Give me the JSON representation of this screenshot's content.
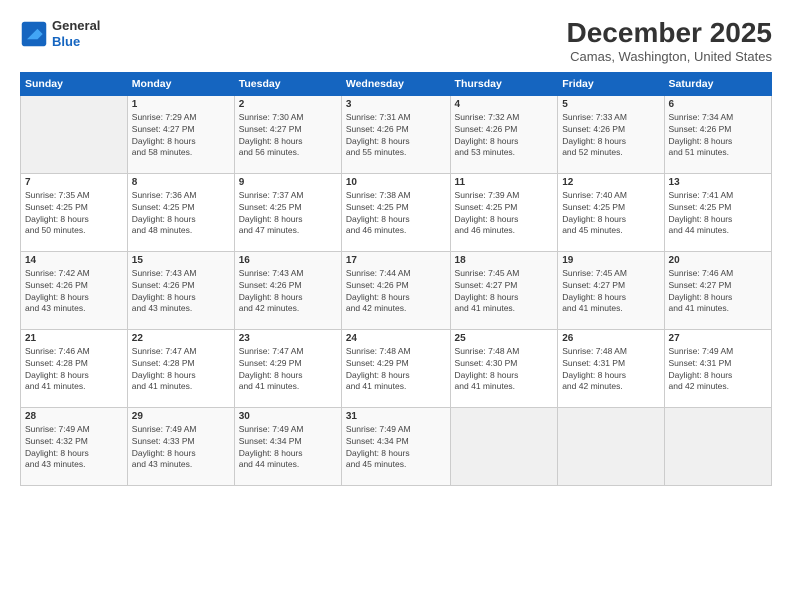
{
  "logo": {
    "line1": "General",
    "line2": "Blue"
  },
  "title": "December 2025",
  "location": "Camas, Washington, United States",
  "days_of_week": [
    "Sunday",
    "Monday",
    "Tuesday",
    "Wednesday",
    "Thursday",
    "Friday",
    "Saturday"
  ],
  "weeks": [
    [
      {
        "day": "",
        "info": ""
      },
      {
        "day": "1",
        "info": "Sunrise: 7:29 AM\nSunset: 4:27 PM\nDaylight: 8 hours\nand 58 minutes."
      },
      {
        "day": "2",
        "info": "Sunrise: 7:30 AM\nSunset: 4:27 PM\nDaylight: 8 hours\nand 56 minutes."
      },
      {
        "day": "3",
        "info": "Sunrise: 7:31 AM\nSunset: 4:26 PM\nDaylight: 8 hours\nand 55 minutes."
      },
      {
        "day": "4",
        "info": "Sunrise: 7:32 AM\nSunset: 4:26 PM\nDaylight: 8 hours\nand 53 minutes."
      },
      {
        "day": "5",
        "info": "Sunrise: 7:33 AM\nSunset: 4:26 PM\nDaylight: 8 hours\nand 52 minutes."
      },
      {
        "day": "6",
        "info": "Sunrise: 7:34 AM\nSunset: 4:26 PM\nDaylight: 8 hours\nand 51 minutes."
      }
    ],
    [
      {
        "day": "7",
        "info": "Sunrise: 7:35 AM\nSunset: 4:25 PM\nDaylight: 8 hours\nand 50 minutes."
      },
      {
        "day": "8",
        "info": "Sunrise: 7:36 AM\nSunset: 4:25 PM\nDaylight: 8 hours\nand 48 minutes."
      },
      {
        "day": "9",
        "info": "Sunrise: 7:37 AM\nSunset: 4:25 PM\nDaylight: 8 hours\nand 47 minutes."
      },
      {
        "day": "10",
        "info": "Sunrise: 7:38 AM\nSunset: 4:25 PM\nDaylight: 8 hours\nand 46 minutes."
      },
      {
        "day": "11",
        "info": "Sunrise: 7:39 AM\nSunset: 4:25 PM\nDaylight: 8 hours\nand 46 minutes."
      },
      {
        "day": "12",
        "info": "Sunrise: 7:40 AM\nSunset: 4:25 PM\nDaylight: 8 hours\nand 45 minutes."
      },
      {
        "day": "13",
        "info": "Sunrise: 7:41 AM\nSunset: 4:25 PM\nDaylight: 8 hours\nand 44 minutes."
      }
    ],
    [
      {
        "day": "14",
        "info": "Sunrise: 7:42 AM\nSunset: 4:26 PM\nDaylight: 8 hours\nand 43 minutes."
      },
      {
        "day": "15",
        "info": "Sunrise: 7:43 AM\nSunset: 4:26 PM\nDaylight: 8 hours\nand 43 minutes."
      },
      {
        "day": "16",
        "info": "Sunrise: 7:43 AM\nSunset: 4:26 PM\nDaylight: 8 hours\nand 42 minutes."
      },
      {
        "day": "17",
        "info": "Sunrise: 7:44 AM\nSunset: 4:26 PM\nDaylight: 8 hours\nand 42 minutes."
      },
      {
        "day": "18",
        "info": "Sunrise: 7:45 AM\nSunset: 4:27 PM\nDaylight: 8 hours\nand 41 minutes."
      },
      {
        "day": "19",
        "info": "Sunrise: 7:45 AM\nSunset: 4:27 PM\nDaylight: 8 hours\nand 41 minutes."
      },
      {
        "day": "20",
        "info": "Sunrise: 7:46 AM\nSunset: 4:27 PM\nDaylight: 8 hours\nand 41 minutes."
      }
    ],
    [
      {
        "day": "21",
        "info": "Sunrise: 7:46 AM\nSunset: 4:28 PM\nDaylight: 8 hours\nand 41 minutes."
      },
      {
        "day": "22",
        "info": "Sunrise: 7:47 AM\nSunset: 4:28 PM\nDaylight: 8 hours\nand 41 minutes."
      },
      {
        "day": "23",
        "info": "Sunrise: 7:47 AM\nSunset: 4:29 PM\nDaylight: 8 hours\nand 41 minutes."
      },
      {
        "day": "24",
        "info": "Sunrise: 7:48 AM\nSunset: 4:29 PM\nDaylight: 8 hours\nand 41 minutes."
      },
      {
        "day": "25",
        "info": "Sunrise: 7:48 AM\nSunset: 4:30 PM\nDaylight: 8 hours\nand 41 minutes."
      },
      {
        "day": "26",
        "info": "Sunrise: 7:48 AM\nSunset: 4:31 PM\nDaylight: 8 hours\nand 42 minutes."
      },
      {
        "day": "27",
        "info": "Sunrise: 7:49 AM\nSunset: 4:31 PM\nDaylight: 8 hours\nand 42 minutes."
      }
    ],
    [
      {
        "day": "28",
        "info": "Sunrise: 7:49 AM\nSunset: 4:32 PM\nDaylight: 8 hours\nand 43 minutes."
      },
      {
        "day": "29",
        "info": "Sunrise: 7:49 AM\nSunset: 4:33 PM\nDaylight: 8 hours\nand 43 minutes."
      },
      {
        "day": "30",
        "info": "Sunrise: 7:49 AM\nSunset: 4:34 PM\nDaylight: 8 hours\nand 44 minutes."
      },
      {
        "day": "31",
        "info": "Sunrise: 7:49 AM\nSunset: 4:34 PM\nDaylight: 8 hours\nand 45 minutes."
      },
      {
        "day": "",
        "info": ""
      },
      {
        "day": "",
        "info": ""
      },
      {
        "day": "",
        "info": ""
      }
    ]
  ]
}
